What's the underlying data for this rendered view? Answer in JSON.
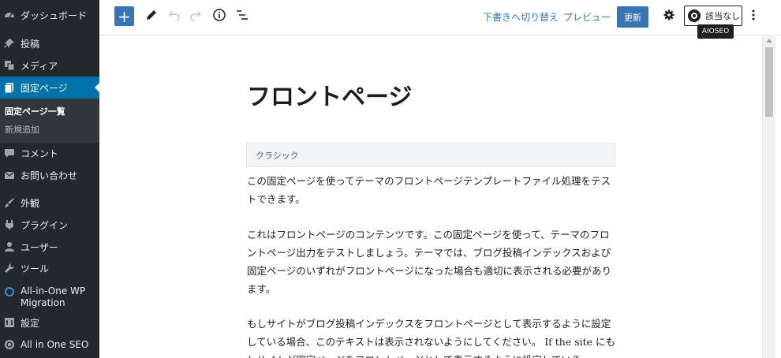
{
  "sidebar": {
    "items": [
      {
        "label": "ダッシュボード",
        "icon": "dashboard-icon"
      },
      {
        "label": "投稿",
        "icon": "pin-icon"
      },
      {
        "label": "メディア",
        "icon": "media-icon"
      },
      {
        "label": "固定ページ",
        "icon": "pages-icon"
      },
      {
        "label": "コメント",
        "icon": "comment-icon"
      },
      {
        "label": "お問い合わせ",
        "icon": "mail-icon"
      },
      {
        "label": "外観",
        "icon": "brush-icon"
      },
      {
        "label": "プラグイン",
        "icon": "plugin-icon"
      },
      {
        "label": "ユーザー",
        "icon": "user-icon"
      },
      {
        "label": "ツール",
        "icon": "wrench-icon"
      },
      {
        "label": "All-in-One WP Migration",
        "icon": "migration-icon"
      },
      {
        "label": "設定",
        "icon": "settings-icon"
      },
      {
        "label": "All in One SEO",
        "icon": "aioseo-icon"
      }
    ],
    "submenu": [
      {
        "label": "固定ページ一覧"
      },
      {
        "label": "新規追加"
      }
    ]
  },
  "toolbar": {
    "add_label": "+",
    "switch_draft": "下書きへ切り替え",
    "preview": "プレビュー",
    "update": "更新",
    "aioseo_score": "該当なし",
    "tooltip": "AIOSEO"
  },
  "editor": {
    "title": "フロントページ",
    "classic_block": "クラシック",
    "paragraphs": [
      "この固定ページを使ってテーマのフロントページテンプレートファイル処理をテストできます。",
      "これはフロントページのコンテンツです。この固定ページを使って、テーマのフロントページ出力をテストしましょう。テーマでは、ブログ投稿インデックスおよび固定ページのいずれがフロントページになった場合も適切に表示される必要があります。",
      "もしサイトがブログ投稿インデックスをフロントページとして表示するように設定している場合、このテキストは表示されないようにしてください。 If the site にもしサイトが固定ページをフロントページとして表示するように設定している"
    ]
  },
  "colors": {
    "sidebar_bg": "#23282d",
    "accent": "#3676b6",
    "active_menu": "#0073aa"
  }
}
